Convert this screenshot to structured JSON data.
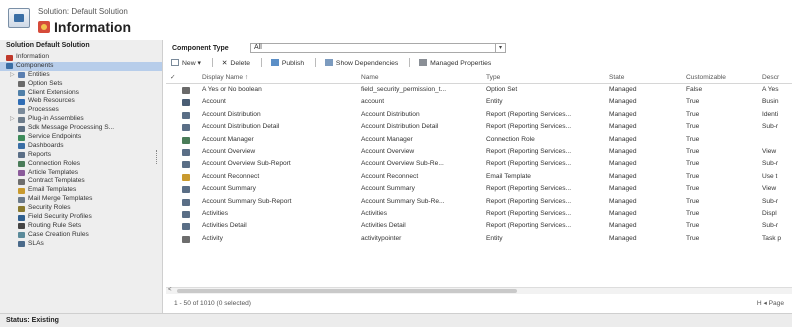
{
  "header": {
    "breadcrumb": "Solution: Default Solution",
    "title": "Information"
  },
  "sidebar": {
    "title": "Solution Default Solution",
    "items": [
      {
        "label": "Information",
        "level": 0,
        "icon": "info-icon",
        "color": "#c0392b"
      },
      {
        "label": "Components",
        "level": 0,
        "icon": "components-icon",
        "color": "#3a6ea5",
        "selected": true
      },
      {
        "label": "Entities",
        "level": 1,
        "icon": "entities-icon",
        "color": "#5b7fb0",
        "expandable": true
      },
      {
        "label": "Option Sets",
        "level": 1,
        "icon": "option-sets-icon",
        "color": "#6a6a6a"
      },
      {
        "label": "Client Extensions",
        "level": 1,
        "icon": "client-extensions-icon",
        "color": "#4f7fa8"
      },
      {
        "label": "Web Resources",
        "level": 1,
        "icon": "web-resources-icon",
        "color": "#2f6db5"
      },
      {
        "label": "Processes",
        "level": 1,
        "icon": "processes-icon",
        "color": "#7a8a9a"
      },
      {
        "label": "Plug-in Assemblies",
        "level": 1,
        "icon": "plugin-assemblies-icon",
        "color": "#6d7c8b",
        "expandable": true
      },
      {
        "label": "Sdk Message Processing S...",
        "level": 1,
        "icon": "sdk-message-icon",
        "color": "#5c6f82"
      },
      {
        "label": "Service Endpoints",
        "level": 1,
        "icon": "service-endpoints-icon",
        "color": "#3d8b5a"
      },
      {
        "label": "Dashboards",
        "level": 1,
        "icon": "dashboards-icon",
        "color": "#3a6ea5"
      },
      {
        "label": "Reports",
        "level": 1,
        "icon": "reports-icon",
        "color": "#5a6e86"
      },
      {
        "label": "Connection Roles",
        "level": 1,
        "icon": "connection-roles-icon",
        "color": "#4a7c59"
      },
      {
        "label": "Article Templates",
        "level": 1,
        "icon": "article-templates-icon",
        "color": "#8a5a9a"
      },
      {
        "label": "Contract Templates",
        "level": 1,
        "icon": "contract-templates-icon",
        "color": "#6d6d6d"
      },
      {
        "label": "Email Templates",
        "level": 1,
        "icon": "email-templates-icon",
        "color": "#c99a2e"
      },
      {
        "label": "Mail Merge Templates",
        "level": 1,
        "icon": "mail-merge-templates-icon",
        "color": "#6a7a8a"
      },
      {
        "label": "Security Roles",
        "level": 1,
        "icon": "security-roles-icon",
        "color": "#8a7a2e"
      },
      {
        "label": "Field Security Profiles",
        "level": 1,
        "icon": "field-security-profiles-icon",
        "color": "#2f5f8f"
      },
      {
        "label": "Routing Rule Sets",
        "level": 1,
        "icon": "routing-rule-sets-icon",
        "color": "#444444"
      },
      {
        "label": "Case Creation Rules",
        "level": 1,
        "icon": "case-creation-rules-icon",
        "color": "#5a8a9a"
      },
      {
        "label": "SLAs",
        "level": 1,
        "icon": "slas-icon",
        "color": "#4a6a8a"
      }
    ]
  },
  "filter": {
    "label": "Component Type",
    "value": "All"
  },
  "toolbar": {
    "new_label": "New",
    "delete_label": "Delete",
    "publish_label": "Publish",
    "show_dependencies_label": "Show Dependencies",
    "managed_properties_label": "Managed Properties"
  },
  "grid": {
    "columns": {
      "display_name": "Display Name ↑",
      "name": "Name",
      "type": "Type",
      "state": "State",
      "customizable": "Customizable",
      "description": "Descr"
    },
    "rows": [
      {
        "display": "A Yes or No boolean",
        "name": "field_security_permission_t...",
        "type": "Option Set",
        "state": "Managed",
        "cust": "False",
        "desc": "A Yes",
        "icon_color": "#6a6a6a"
      },
      {
        "display": "Account",
        "name": "account",
        "type": "Entity",
        "state": "Managed",
        "cust": "True",
        "desc": "Busin",
        "icon_color": "#4a5d74"
      },
      {
        "display": "Account Distribution",
        "name": "Account Distribution",
        "type": "Report (Reporting Services...",
        "state": "Managed",
        "cust": "True",
        "desc": "Identi",
        "icon_color": "#5a6e86"
      },
      {
        "display": "Account Distribution Detail",
        "name": "Account Distribution Detail",
        "type": "Report (Reporting Services...",
        "state": "Managed",
        "cust": "True",
        "desc": "Sub-r",
        "icon_color": "#5a6e86"
      },
      {
        "display": "Account Manager",
        "name": "Account Manager",
        "type": "Connection Role",
        "state": "Managed",
        "cust": "True",
        "desc": "",
        "icon_color": "#4a7c59"
      },
      {
        "display": "Account Overview",
        "name": "Account Overview",
        "type": "Report (Reporting Services...",
        "state": "Managed",
        "cust": "True",
        "desc": "View",
        "icon_color": "#5a6e86"
      },
      {
        "display": "Account Overview Sub-Report",
        "name": "Account Overview Sub-Re...",
        "type": "Report (Reporting Services...",
        "state": "Managed",
        "cust": "True",
        "desc": "Sub-r",
        "icon_color": "#5a6e86"
      },
      {
        "display": "Account Reconnect",
        "name": "Account Reconnect",
        "type": "Email Template",
        "state": "Managed",
        "cust": "True",
        "desc": "Use t",
        "icon_color": "#c99a2e"
      },
      {
        "display": "Account Summary",
        "name": "Account Summary",
        "type": "Report (Reporting Services...",
        "state": "Managed",
        "cust": "True",
        "desc": "View",
        "icon_color": "#5a6e86"
      },
      {
        "display": "Account Summary Sub-Report",
        "name": "Account Summary Sub-Re...",
        "type": "Report (Reporting Services...",
        "state": "Managed",
        "cust": "True",
        "desc": "Sub-r",
        "icon_color": "#5a6e86"
      },
      {
        "display": "Activities",
        "name": "Activities",
        "type": "Report (Reporting Services...",
        "state": "Managed",
        "cust": "True",
        "desc": "Displ",
        "icon_color": "#5a6e86"
      },
      {
        "display": "Activities Detail",
        "name": "Activities Detail",
        "type": "Report (Reporting Services...",
        "state": "Managed",
        "cust": "True",
        "desc": "Sub-r",
        "icon_color": "#5a6e86"
      },
      {
        "display": "Activity",
        "name": "activitypointer",
        "type": "Entity",
        "state": "Managed",
        "cust": "True",
        "desc": "Task p",
        "icon_color": "#6d6d6d"
      }
    ]
  },
  "footer": {
    "record_count": "1 - 50 of 1010 (0 selected)",
    "pager": "H ◂ Page"
  },
  "status": {
    "text": "Status: Existing"
  }
}
